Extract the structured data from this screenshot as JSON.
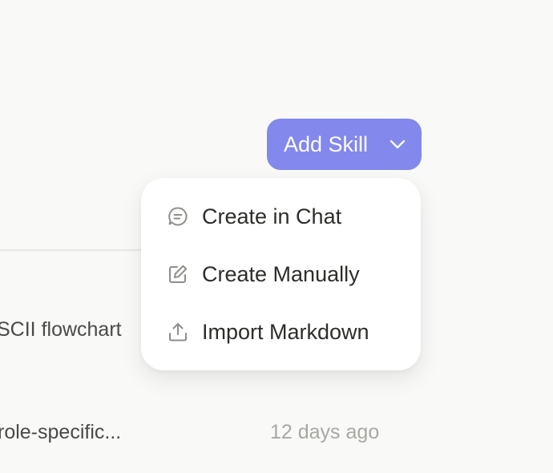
{
  "header": {
    "add_skill_label": "Add Skill"
  },
  "dropdown": {
    "items": [
      {
        "label": "Create in Chat",
        "icon": "chat-bubble-icon"
      },
      {
        "label": "Create Manually",
        "icon": "edit-icon"
      },
      {
        "label": "Import Markdown",
        "icon": "upload-icon"
      }
    ]
  },
  "skills_list": {
    "rows": [
      {
        "description": "SCII flowchart"
      },
      {
        "description": "role-specific...",
        "updated": "12 days ago"
      }
    ]
  },
  "colors": {
    "accent": "#8288ec",
    "background": "#f9f9f8",
    "menu_background": "#ffffff",
    "text_primary": "#2d2d2a",
    "text_muted": "#a8a8a3"
  }
}
